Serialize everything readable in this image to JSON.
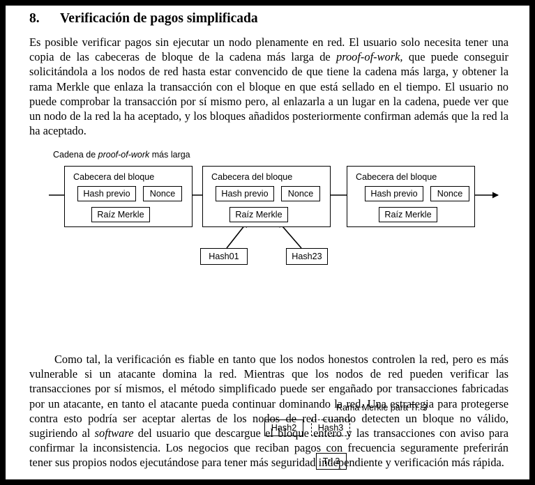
{
  "section": {
    "number": "8.",
    "title": "Verificación de pagos simplificada"
  },
  "paragraphs": {
    "p1_a": "Es posible verificar pagos sin ejecutar un nodo plenamente en red. El usuario solo necesita tener una copia de las cabeceras de bloque de la cadena más larga de ",
    "p1_em": "proof-of-work,",
    "p1_b": " que puede conseguir solicitándola a los nodos de red hasta estar convencido de que tiene la cadena más larga, y obtener la rama Merkle que enlaza la transacción con el bloque en que está sellado en el tiempo. El usuario no puede comprobar la transacción por sí mismo pero, al enlazarla a un lugar en la cadena, puede ver que un nodo de la red la ha aceptado, y los bloques añadidos posteriormente confirman además que la red la ha aceptado.",
    "p2_a": "Como tal, la verificación es fiable en tanto que los nodos honestos controlen la red, pero es más vulnerable si un atacante domina la red. Mientras que los nodos de red pueden verificar las transacciones por sí mismos, el método simplificado puede ser engañado por transacciones fabricadas por un atacante, en tanto el atacante pueda continuar dominando la red. Una estrategia para protegerse contra esto podría ser aceptar alertas de los nodos de red cuando detecten un bloque no válido, sugiriendo al ",
    "p2_em": "software",
    "p2_b": " del usuario que descargue el bloque entero y las transacciones con aviso para confirmar la inconsistencia. Los negocios que reciban pagos con frecuencia seguramente preferirán tener sus propios nodos ejecutándose para tener más seguridad independiente y verificación más rápida."
  },
  "diagram": {
    "chain_label_a": "Cadena de ",
    "chain_label_em": "proof-of-work",
    "chain_label_b": " más larga",
    "branch_label": "Rama Merkle para Tr. 3",
    "blocks": [
      {
        "title": "Cabecera del bloque",
        "prev": "Hash previo",
        "nonce": "Nonce",
        "merkle": "Raíz Merkle"
      },
      {
        "title": "Cabecera del bloque",
        "prev": "Hash previo",
        "nonce": "Nonce",
        "merkle": "Raíz Merkle"
      },
      {
        "title": "Cabecera del bloque",
        "prev": "Hash previo",
        "nonce": "Nonce",
        "merkle": "Raíz Merkle"
      }
    ],
    "tree": {
      "hash01": "Hash01",
      "hash23": "Hash23",
      "hash2": "Hash2",
      "hash3": "Hash3",
      "tx3": "Tr. 3"
    }
  },
  "colors": {
    "page_background": "#ffffff",
    "frame": "#000000",
    "text": "#000000"
  }
}
